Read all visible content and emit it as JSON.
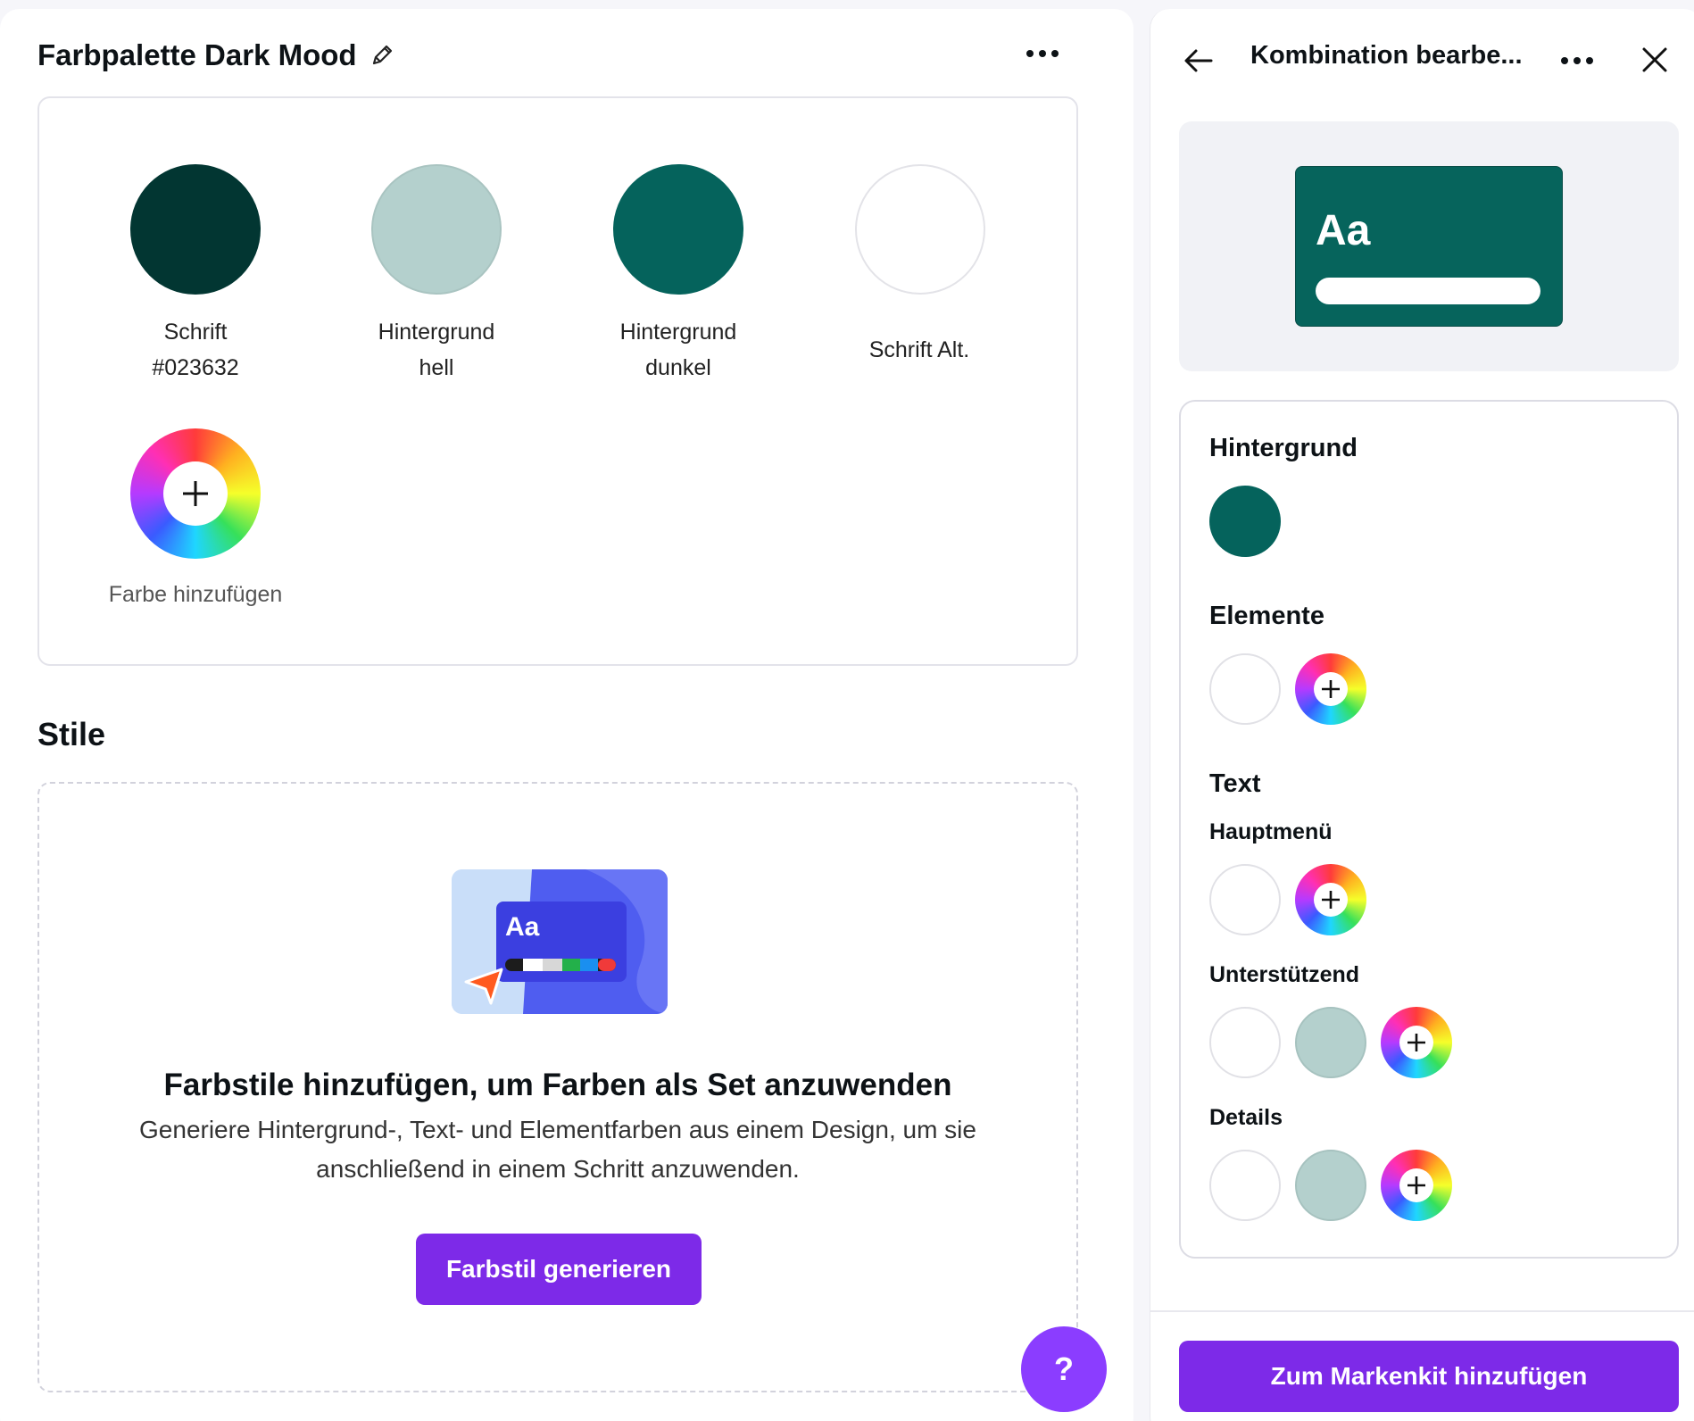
{
  "palette": {
    "title": "Farbpalette Dark Mood",
    "colors": [
      {
        "label_line1": "Schrift",
        "label_line2": "#023632",
        "hex": "#023632"
      },
      {
        "label_line1": "Hintergrund",
        "label_line2": "hell",
        "hex": "#b4d0cd"
      },
      {
        "label_line1": "Hintergrund",
        "label_line2": "dunkel",
        "hex": "#05635c"
      },
      {
        "label_line1": "Schrift Alt.",
        "label_line2": "",
        "hex": "#ffffff"
      }
    ],
    "add_color_label": "Farbe hinzufügen"
  },
  "styles": {
    "title": "Stile",
    "illustration_text": "Aa",
    "empty_heading": "Farbstile hinzufügen, um Farben als Set anzuwenden",
    "empty_desc": "Generiere Hintergrund-, Text- und Elementfarben aus einem Design, um sie anschließend in einem Schritt anzuwenden.",
    "generate_button": "Farbstil generieren"
  },
  "help_button": "?",
  "right_panel": {
    "title": "Kombination bearbe...",
    "preview_text": "Aa",
    "preview_bg": "#05635c",
    "sections": {
      "background": {
        "label": "Hintergrund",
        "colors": [
          "#05635c"
        ]
      },
      "elements": {
        "label": "Elemente",
        "colors": [
          "#ffffff"
        ]
      },
      "text": {
        "label": "Text"
      },
      "main_menu": {
        "label": "Hauptmenü",
        "colors": [
          "#ffffff"
        ]
      },
      "supporting": {
        "label": "Unterstützend",
        "colors": [
          "#ffffff",
          "#b4d0cd"
        ]
      },
      "details": {
        "label": "Details",
        "colors": [
          "#ffffff",
          "#b4d0cd"
        ]
      }
    },
    "add_to_brandkit": "Zum Markenkit hinzufügen"
  },
  "icons": {
    "edit": "pencil-icon",
    "more": "more-horizontal-icon",
    "back": "arrow-left-icon",
    "close": "close-icon",
    "add": "plus-icon"
  }
}
